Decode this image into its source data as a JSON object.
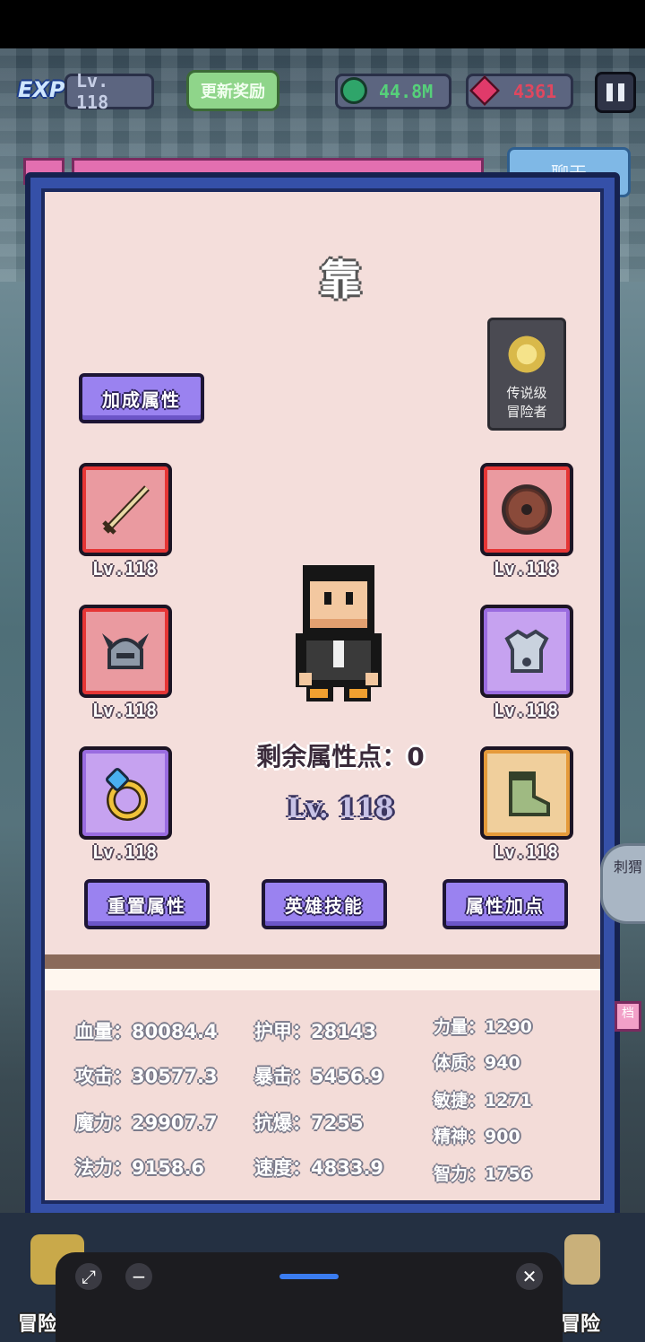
{
  "hud": {
    "exp_badge": "EXP",
    "player_level": "Lv. 118",
    "update_reward": "更新奖励",
    "gems": "44.8M",
    "rubies": "4361"
  },
  "chat_tab": "聊天",
  "panel": {
    "title_glyph": "靠",
    "bonus_button": "加成属性",
    "title_card": {
      "line1": "传说级",
      "line2": "冒险者"
    },
    "slots": [
      {
        "name": "weapon",
        "level": "Lv.118",
        "rarity": "red"
      },
      {
        "name": "shield",
        "level": "Lv.118",
        "rarity": "red"
      },
      {
        "name": "helmet",
        "level": "Lv.118",
        "rarity": "red"
      },
      {
        "name": "armor",
        "level": "Lv.118",
        "rarity": "purple"
      },
      {
        "name": "ring",
        "level": "Lv.118",
        "rarity": "purple"
      },
      {
        "name": "boots",
        "level": "Lv.118",
        "rarity": "orange"
      }
    ],
    "remaining_points": "剩余属性点：0",
    "hero_level": "Lv. 118",
    "buttons": {
      "reset": "重置属性",
      "skills": "英雄技能",
      "add_points": "属性加点"
    }
  },
  "stats": {
    "col1": [
      "血量：80084.4",
      "攻击：30577.3",
      "魔力：29907.7",
      "法力：9158.6"
    ],
    "col2": [
      "护甲：28143",
      "暴击：5456.9",
      "抗爆：7255",
      "速度：4833.9"
    ],
    "col3": [
      "力量：1290",
      "体质：940",
      "敏捷：1271",
      "精神：900",
      "智力：1756"
    ]
  },
  "side_bubble": "刺猬",
  "side_tab": "档",
  "bottom_nav": {
    "left_label": "冒险",
    "right_label": "冒险"
  },
  "sheet": {
    "expand_icon": "expand-icon",
    "minimize_icon": "minimize-icon",
    "close_icon": "close-icon"
  },
  "colors": {
    "frame": "#3550a8",
    "panel_bg": "#f4dedb",
    "button_purple": "#9a82f0",
    "slot_red": "#e53535",
    "slot_purple": "#9a6ce0",
    "slot_orange": "#e59a3a",
    "gem_green": "#56d07a",
    "ruby_red": "#e0475f"
  }
}
